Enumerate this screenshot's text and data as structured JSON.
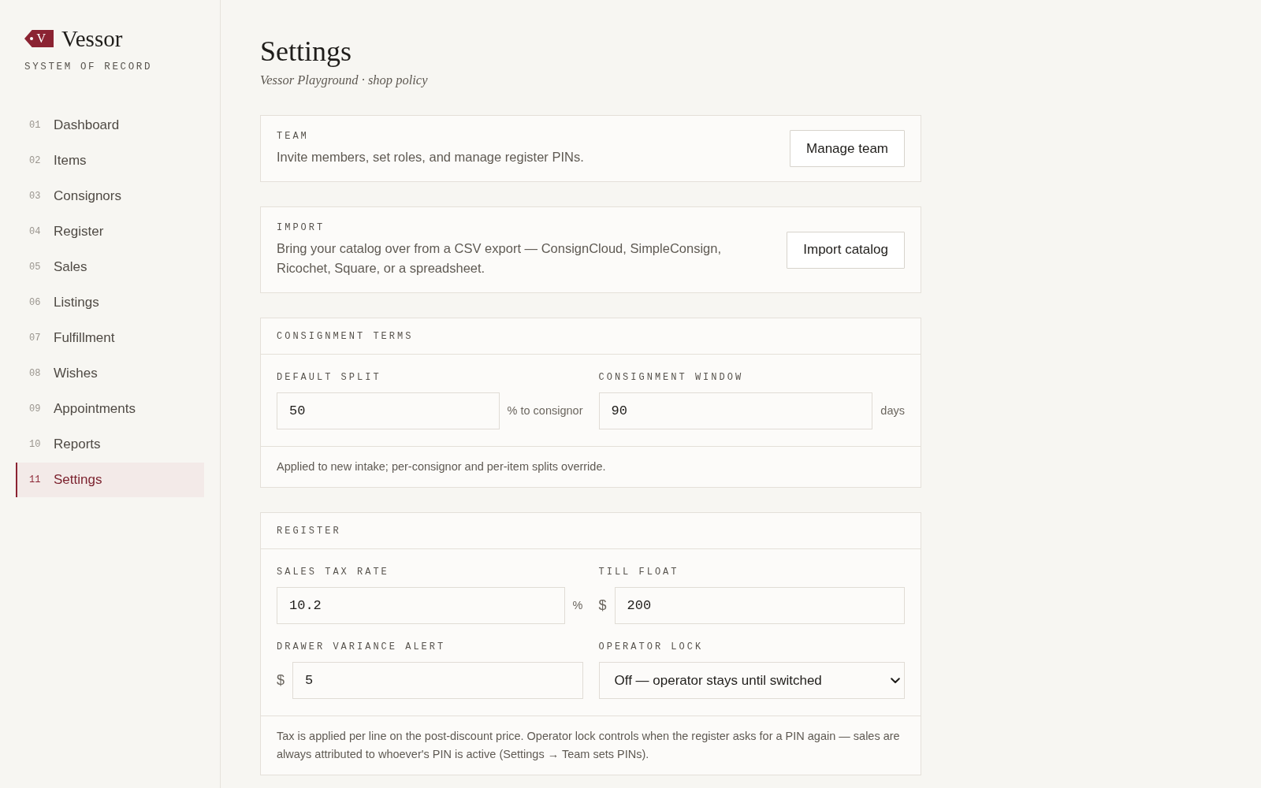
{
  "brand": {
    "mark": "V",
    "name": "Vessor",
    "tagline": "SYSTEM OF RECORD"
  },
  "sidebar": {
    "items": [
      {
        "number": "01",
        "label": "Dashboard",
        "selected": false
      },
      {
        "number": "02",
        "label": "Items",
        "selected": false
      },
      {
        "number": "03",
        "label": "Consignors",
        "selected": false
      },
      {
        "number": "04",
        "label": "Register",
        "selected": false
      },
      {
        "number": "05",
        "label": "Sales",
        "selected": false
      },
      {
        "number": "06",
        "label": "Listings",
        "selected": false
      },
      {
        "number": "07",
        "label": "Fulfillment",
        "selected": false
      },
      {
        "number": "08",
        "label": "Wishes",
        "selected": false
      },
      {
        "number": "09",
        "label": "Appointments",
        "selected": false
      },
      {
        "number": "10",
        "label": "Reports",
        "selected": false
      },
      {
        "number": "11",
        "label": "Settings",
        "selected": true
      }
    ]
  },
  "page": {
    "title": "Settings",
    "subtitle": "Vessor Playground · shop policy"
  },
  "sections": [
    {
      "kind": "action",
      "title": "TEAM",
      "description": "Invite members, set roles, and manage register PINs.",
      "button": "Manage team"
    },
    {
      "kind": "action",
      "title": "IMPORT",
      "description": "Bring your catalog over from a CSV export — ConsignCloud, SimpleConsign, Ricochet, Square, or a spreadsheet.",
      "button": "Import catalog"
    },
    {
      "kind": "form",
      "title": "CONSIGNMENT TERMS",
      "fields": [
        {
          "kind": "input",
          "label": "DEFAULT SPLIT",
          "value": "50",
          "suffix": "% to consignor"
        },
        {
          "kind": "input",
          "label": "CONSIGNMENT WINDOW",
          "value": "90",
          "suffix": "days"
        }
      ],
      "note": "Applied to new intake; per-consignor and per-item splits override."
    },
    {
      "kind": "form",
      "title": "REGISTER",
      "fields": [
        {
          "kind": "input",
          "label": "SALES TAX RATE",
          "value": "10.2",
          "suffix": "%"
        },
        {
          "kind": "input",
          "label": "TILL FLOAT",
          "prefix": "$",
          "value": "200"
        },
        {
          "kind": "input",
          "label": "DRAWER VARIANCE ALERT",
          "prefix": "$",
          "value": "5"
        },
        {
          "kind": "select",
          "label": "OPERATOR LOCK",
          "value": "Off — operator stays until switched"
        }
      ],
      "note": "Tax is applied per line on the post-discount price. Operator lock controls when the register asks for a PIN again — sales are always attributed to whoever's PIN is active (Settings → Team sets PINs)."
    }
  ]
}
